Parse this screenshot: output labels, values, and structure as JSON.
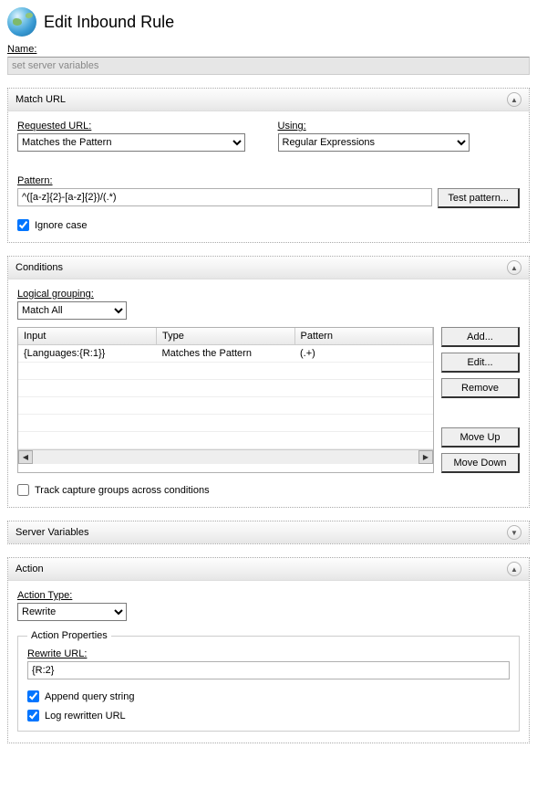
{
  "page_title": "Edit Inbound Rule",
  "name": {
    "label": "Name:",
    "value": "set server variables"
  },
  "match_url": {
    "title": "Match URL",
    "requested_url": {
      "label": "Requested URL:",
      "value": "Matches the Pattern"
    },
    "using": {
      "label": "Using:",
      "value": "Regular Expressions"
    },
    "pattern": {
      "label": "Pattern:",
      "value": "^([a-z]{2}-[a-z]{2})/(.*)"
    },
    "test_button": "Test pattern...",
    "ignore_case": {
      "label": "Ignore case",
      "checked": true
    }
  },
  "conditions": {
    "title": "Conditions",
    "logical_grouping": {
      "label": "Logical grouping:",
      "value": "Match All"
    },
    "columns": [
      "Input",
      "Type",
      "Pattern"
    ],
    "rows": [
      {
        "input": "{Languages:{R:1}}",
        "type": "Matches the Pattern",
        "pattern": "(.+)"
      }
    ],
    "buttons": {
      "add": "Add...",
      "edit": "Edit...",
      "remove": "Remove",
      "move_up": "Move Up",
      "move_down": "Move Down"
    },
    "track_groups": {
      "label": "Track capture groups across conditions",
      "checked": false
    }
  },
  "server_variables": {
    "title": "Server Variables"
  },
  "action": {
    "title": "Action",
    "action_type": {
      "label": "Action Type:",
      "value": "Rewrite"
    },
    "properties_title": "Action Properties",
    "rewrite_url": {
      "label": "Rewrite URL:",
      "value": "{R:2}"
    },
    "append_qs": {
      "label": "Append query string",
      "checked": true
    },
    "log_rewritten": {
      "label": "Log rewritten URL",
      "checked": true
    }
  }
}
